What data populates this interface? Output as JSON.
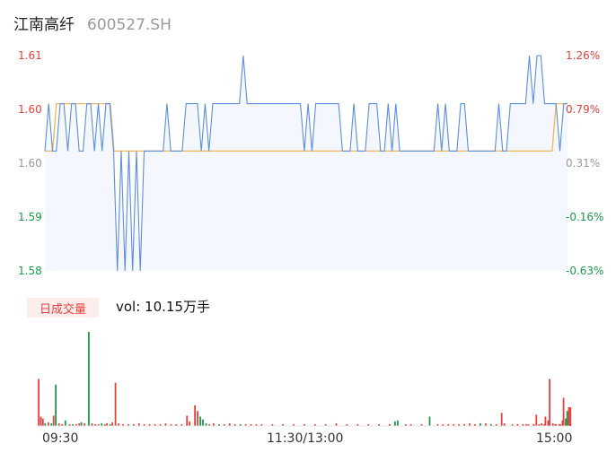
{
  "header": {
    "stock_name": "江南高纤",
    "stock_code": "600527.SH"
  },
  "colors": {
    "up": "#e8413c",
    "down": "#1a9b4a",
    "neutral": "#999999",
    "price_line": "#5b8fde",
    "avg_line": "#f0b45a",
    "area_fill": "#f4f7fd"
  },
  "price_axis": {
    "left_labels": [
      "1.61",
      "1.60",
      "1.60",
      "1.59",
      "1.58"
    ],
    "right_labels": [
      "1.26%",
      "0.79%",
      "0.31%",
      "-0.16%",
      "-0.63%"
    ],
    "label_colors": [
      "#e8413c",
      "#e8413c",
      "#999999",
      "#1a9b4a",
      "#1a9b4a"
    ]
  },
  "volume_panel": {
    "badge": "日成交量",
    "volume_text": "vol: 10.15万手"
  },
  "x_axis": {
    "labels": [
      "09:30",
      "11:30/13:00",
      "15:00"
    ]
  },
  "chart_data": {
    "type": "line",
    "x_range": [
      "09:30",
      "15:00"
    ],
    "ylim": [
      1.58,
      1.61
    ],
    "prev_close": 1.5975,
    "series": [
      {
        "values": [
          1.5967,
          1.6033,
          1.5967,
          1.5967,
          1.6033,
          1.6033,
          1.5967,
          1.6033,
          1.6033,
          1.5967,
          1.5967,
          1.6033,
          1.6033,
          1.5967,
          1.6033,
          1.5967,
          1.6033,
          1.6033,
          1.5967,
          1.58,
          1.5967,
          1.58,
          1.5967,
          1.58,
          1.5967,
          1.58,
          1.5967,
          1.5967,
          1.5967,
          1.5967,
          1.5967,
          1.5967,
          1.6033,
          1.5967,
          1.5967,
          1.5967,
          1.5967,
          1.6033,
          1.6033,
          1.6033,
          1.6033,
          1.5967,
          1.6033,
          1.5967,
          1.6033,
          1.6033,
          1.6033,
          1.6033,
          1.6033,
          1.6033,
          1.6033,
          1.6033,
          1.61,
          1.6033,
          1.6033,
          1.6033,
          1.6033,
          1.6033,
          1.6033,
          1.6033,
          1.6033,
          1.6033,
          1.6033,
          1.6033,
          1.6033,
          1.6033,
          1.6033,
          1.6033,
          1.5967,
          1.6033,
          1.5967,
          1.6033,
          1.6033,
          1.6033,
          1.6033,
          1.6033,
          1.6033,
          1.6033,
          1.5967,
          1.5967,
          1.5967,
          1.6033,
          1.5967,
          1.5967,
          1.5967,
          1.6033,
          1.6033,
          1.6033,
          1.5967,
          1.5967,
          1.6033,
          1.5967,
          1.6033,
          1.5967,
          1.5967,
          1.5967,
          1.5967,
          1.5967,
          1.5967,
          1.5967,
          1.5967,
          1.5967,
          1.5967,
          1.6033,
          1.5967,
          1.6033,
          1.5967,
          1.5967,
          1.5967,
          1.6033,
          1.6033,
          1.5967,
          1.5967,
          1.5967,
          1.5967,
          1.5967,
          1.5967,
          1.5967,
          1.5967,
          1.6033,
          1.5967,
          1.5967,
          1.6033,
          1.6033,
          1.6033,
          1.6033,
          1.6033,
          1.61,
          1.6033,
          1.61,
          1.61,
          1.6033,
          1.6033,
          1.6033,
          1.6033,
          1.5967,
          1.6033,
          1.6033
        ]
      },
      {
        "values": [
          1.5967,
          1.5967,
          1.5967,
          1.6033,
          1.6033,
          1.6033,
          1.6033,
          1.6033,
          1.6033,
          1.6033,
          1.6033,
          1.6033,
          1.6033,
          1.6033,
          1.6033,
          1.6033,
          1.6033,
          1.6033,
          1.5967,
          1.5967,
          1.5967,
          1.5967,
          1.5967,
          1.5967,
          1.5967,
          1.5967,
          1.5967,
          1.5967,
          1.5967,
          1.5967,
          1.5967,
          1.5967,
          1.5967,
          1.5967,
          1.5967,
          1.5967,
          1.5967,
          1.5967,
          1.5967,
          1.5967,
          1.5967,
          1.5967,
          1.5967,
          1.5967,
          1.5967,
          1.5967,
          1.5967,
          1.5967,
          1.5967,
          1.5967,
          1.5967,
          1.5967,
          1.5967,
          1.5967,
          1.5967,
          1.5967,
          1.5967,
          1.5967,
          1.5967,
          1.5967,
          1.5967,
          1.5967,
          1.5967,
          1.5967,
          1.5967,
          1.5967,
          1.5967,
          1.5967,
          1.5967,
          1.5967,
          1.5967,
          1.5967,
          1.5967,
          1.5967,
          1.5967,
          1.5967,
          1.5967,
          1.5967,
          1.5967,
          1.5967,
          1.5967,
          1.5967,
          1.5967,
          1.5967,
          1.5967,
          1.5967,
          1.5967,
          1.5967,
          1.5967,
          1.5967,
          1.5967,
          1.5967,
          1.5967,
          1.5967,
          1.5967,
          1.5967,
          1.5967,
          1.5967,
          1.5967,
          1.5967,
          1.5967,
          1.5967,
          1.5967,
          1.5967,
          1.5967,
          1.5967,
          1.5967,
          1.5967,
          1.5967,
          1.5967,
          1.5967,
          1.5967,
          1.5967,
          1.5967,
          1.5967,
          1.5967,
          1.5967,
          1.5967,
          1.5967,
          1.5967,
          1.5967,
          1.5967,
          1.5967,
          1.5967,
          1.5967,
          1.5967,
          1.5967,
          1.5967,
          1.5967,
          1.5967,
          1.5967,
          1.5967,
          1.5967,
          1.6033,
          1.6033,
          1.6033,
          1.6033
        ]
      }
    ],
    "volume": [
      {
        "t": 0.002,
        "v": 50,
        "c": "up"
      },
      {
        "t": 0.006,
        "v": 10,
        "c": "up"
      },
      {
        "t": 0.01,
        "v": 8,
        "c": "up"
      },
      {
        "t": 0.014,
        "v": 3,
        "c": "down"
      },
      {
        "t": 0.02,
        "v": 4,
        "c": "up"
      },
      {
        "t": 0.026,
        "v": 3,
        "c": "down"
      },
      {
        "t": 0.03,
        "v": 11,
        "c": "up"
      },
      {
        "t": 0.034,
        "v": 44,
        "c": "down"
      },
      {
        "t": 0.04,
        "v": 3,
        "c": "up"
      },
      {
        "t": 0.046,
        "v": 2,
        "c": "up"
      },
      {
        "t": 0.052,
        "v": 6,
        "c": "down"
      },
      {
        "t": 0.06,
        "v": 2,
        "c": "up"
      },
      {
        "t": 0.066,
        "v": 2,
        "c": "down"
      },
      {
        "t": 0.072,
        "v": 2,
        "c": "up"
      },
      {
        "t": 0.078,
        "v": 3,
        "c": "up"
      },
      {
        "t": 0.082,
        "v": 4,
        "c": "down"
      },
      {
        "t": 0.088,
        "v": 3,
        "c": "up"
      },
      {
        "t": 0.096,
        "v": 100,
        "c": "down"
      },
      {
        "t": 0.102,
        "v": 3,
        "c": "up"
      },
      {
        "t": 0.108,
        "v": 2,
        "c": "up"
      },
      {
        "t": 0.114,
        "v": 2,
        "c": "up"
      },
      {
        "t": 0.12,
        "v": 3,
        "c": "down"
      },
      {
        "t": 0.126,
        "v": 2,
        "c": "up"
      },
      {
        "t": 0.13,
        "v": 3,
        "c": "up"
      },
      {
        "t": 0.136,
        "v": 2,
        "c": "down"
      },
      {
        "t": 0.14,
        "v": 4,
        "c": "up"
      },
      {
        "t": 0.146,
        "v": 46,
        "c": "up"
      },
      {
        "t": 0.152,
        "v": 3,
        "c": "up"
      },
      {
        "t": 0.16,
        "v": 2,
        "c": "up"
      },
      {
        "t": 0.17,
        "v": 2,
        "c": "up"
      },
      {
        "t": 0.18,
        "v": 2,
        "c": "up"
      },
      {
        "t": 0.19,
        "v": 3,
        "c": "up"
      },
      {
        "t": 0.2,
        "v": 2,
        "c": "up"
      },
      {
        "t": 0.21,
        "v": 2,
        "c": "up"
      },
      {
        "t": 0.22,
        "v": 2,
        "c": "up"
      },
      {
        "t": 0.23,
        "v": 2,
        "c": "up"
      },
      {
        "t": 0.24,
        "v": 3,
        "c": "up"
      },
      {
        "t": 0.25,
        "v": 2,
        "c": "up"
      },
      {
        "t": 0.26,
        "v": 2,
        "c": "up"
      },
      {
        "t": 0.27,
        "v": 2,
        "c": "up"
      },
      {
        "t": 0.28,
        "v": 11,
        "c": "up"
      },
      {
        "t": 0.285,
        "v": 5,
        "c": "up"
      },
      {
        "t": 0.295,
        "v": 22,
        "c": "up"
      },
      {
        "t": 0.3,
        "v": 16,
        "c": "up"
      },
      {
        "t": 0.305,
        "v": 10,
        "c": "down"
      },
      {
        "t": 0.31,
        "v": 7,
        "c": "down"
      },
      {
        "t": 0.316,
        "v": 3,
        "c": "down"
      },
      {
        "t": 0.322,
        "v": 2,
        "c": "up"
      },
      {
        "t": 0.33,
        "v": 3,
        "c": "up"
      },
      {
        "t": 0.34,
        "v": 2,
        "c": "down"
      },
      {
        "t": 0.35,
        "v": 2,
        "c": "up"
      },
      {
        "t": 0.36,
        "v": 3,
        "c": "up"
      },
      {
        "t": 0.37,
        "v": 2,
        "c": "up"
      },
      {
        "t": 0.38,
        "v": 2,
        "c": "down"
      },
      {
        "t": 0.39,
        "v": 2,
        "c": "up"
      },
      {
        "t": 0.4,
        "v": 2,
        "c": "up"
      },
      {
        "t": 0.41,
        "v": 2,
        "c": "up"
      },
      {
        "t": 0.42,
        "v": 2,
        "c": "up"
      },
      {
        "t": 0.44,
        "v": 2,
        "c": "up"
      },
      {
        "t": 0.46,
        "v": 2,
        "c": "up"
      },
      {
        "t": 0.48,
        "v": 2,
        "c": "up"
      },
      {
        "t": 0.5,
        "v": 2,
        "c": "up"
      },
      {
        "t": 0.52,
        "v": 2,
        "c": "up"
      },
      {
        "t": 0.54,
        "v": 2,
        "c": "up"
      },
      {
        "t": 0.56,
        "v": 3,
        "c": "up"
      },
      {
        "t": 0.58,
        "v": 2,
        "c": "up"
      },
      {
        "t": 0.6,
        "v": 2,
        "c": "up"
      },
      {
        "t": 0.62,
        "v": 2,
        "c": "up"
      },
      {
        "t": 0.64,
        "v": 2,
        "c": "up"
      },
      {
        "t": 0.66,
        "v": 2,
        "c": "up"
      },
      {
        "t": 0.67,
        "v": 5,
        "c": "down"
      },
      {
        "t": 0.675,
        "v": 6,
        "c": "down"
      },
      {
        "t": 0.69,
        "v": 2,
        "c": "up"
      },
      {
        "t": 0.7,
        "v": 2,
        "c": "up"
      },
      {
        "t": 0.72,
        "v": 2,
        "c": "up"
      },
      {
        "t": 0.735,
        "v": 10,
        "c": "down"
      },
      {
        "t": 0.75,
        "v": 2,
        "c": "up"
      },
      {
        "t": 0.76,
        "v": 2,
        "c": "up"
      },
      {
        "t": 0.77,
        "v": 2,
        "c": "up"
      },
      {
        "t": 0.78,
        "v": 2,
        "c": "up"
      },
      {
        "t": 0.79,
        "v": 2,
        "c": "up"
      },
      {
        "t": 0.8,
        "v": 2,
        "c": "up"
      },
      {
        "t": 0.81,
        "v": 3,
        "c": "up"
      },
      {
        "t": 0.82,
        "v": 2,
        "c": "up"
      },
      {
        "t": 0.83,
        "v": 3,
        "c": "down"
      },
      {
        "t": 0.84,
        "v": 3,
        "c": "up"
      },
      {
        "t": 0.85,
        "v": 2,
        "c": "down"
      },
      {
        "t": 0.86,
        "v": 2,
        "c": "up"
      },
      {
        "t": 0.87,
        "v": 14,
        "c": "up"
      },
      {
        "t": 0.875,
        "v": 3,
        "c": "up"
      },
      {
        "t": 0.89,
        "v": 2,
        "c": "up"
      },
      {
        "t": 0.9,
        "v": 2,
        "c": "up"
      },
      {
        "t": 0.91,
        "v": 2,
        "c": "up"
      },
      {
        "t": 0.92,
        "v": 2,
        "c": "up"
      },
      {
        "t": 0.93,
        "v": 2,
        "c": "up"
      },
      {
        "t": 0.94,
        "v": 2,
        "c": "up"
      },
      {
        "t": 0.95,
        "v": 2,
        "c": "up"
      },
      {
        "t": 0.96,
        "v": 2,
        "c": "up"
      },
      {
        "t": 0.97,
        "v": 2,
        "c": "up"
      },
      {
        "t": 0.98,
        "v": 2,
        "c": "up"
      },
      {
        "t": 0.9,
        "v": 2,
        "c": "up"
      },
      {
        "t": 0.916,
        "v": 2,
        "c": "up"
      },
      {
        "t": 0.93,
        "v": 2,
        "c": "up"
      },
      {
        "t": 0.935,
        "v": 12,
        "c": "up"
      },
      {
        "t": 0.945,
        "v": 3,
        "c": "up"
      },
      {
        "t": 0.952,
        "v": 10,
        "c": "up"
      },
      {
        "t": 0.957,
        "v": 6,
        "c": "up"
      },
      {
        "t": 0.96,
        "v": 50,
        "c": "up"
      },
      {
        "t": 0.966,
        "v": 3,
        "c": "up"
      },
      {
        "t": 0.972,
        "v": 2,
        "c": "up"
      },
      {
        "t": 0.978,
        "v": 2,
        "c": "up"
      },
      {
        "t": 0.984,
        "v": 6,
        "c": "up"
      },
      {
        "t": 0.986,
        "v": 30,
        "c": "up"
      },
      {
        "t": 0.99,
        "v": 8,
        "c": "down"
      },
      {
        "t": 0.993,
        "v": 16,
        "c": "down"
      },
      {
        "t": 0.996,
        "v": 20,
        "c": "up"
      },
      {
        "t": 0.999,
        "v": 20,
        "c": "up"
      }
    ],
    "volume_max": 100
  }
}
